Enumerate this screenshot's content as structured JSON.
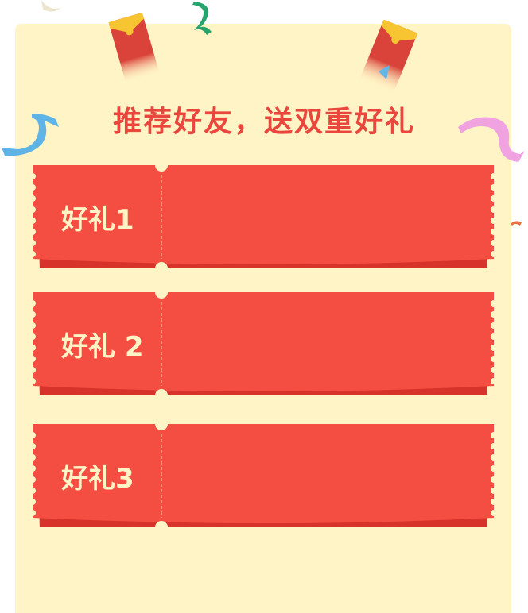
{
  "headline": "推荐好友，送双重好礼",
  "coupons": [
    {
      "label": "好礼1"
    },
    {
      "label": "好礼 2"
    },
    {
      "label": "好礼3"
    }
  ],
  "colors": {
    "background": "#fff4c5",
    "coupon_red": "#f44d42",
    "coupon_shadow": "#d8332a",
    "headline_red": "#e9473e",
    "label_cream": "#fff4c5"
  },
  "decorations": [
    "red-envelope-icon",
    "red-envelope-icon",
    "confetti-ribbon-icon",
    "confetti-ribbon-icon",
    "confetti-ribbon-icon"
  ]
}
